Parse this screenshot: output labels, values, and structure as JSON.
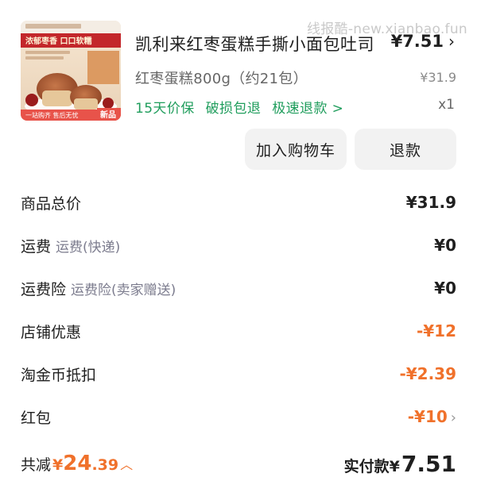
{
  "watermark": "线报酷-new.xianbao.fun",
  "product": {
    "image_alt": "凯利来红枣蛋糕商品图",
    "image_banner": "浓郁枣香 口口软糯",
    "image_badge": "新品",
    "image_footer": "一站购齐 售后无忧",
    "title": "凯利来红枣蛋糕手撕小面包吐司",
    "price": "¥7.51",
    "spec": "红枣蛋糕800g（约21包）",
    "original_price": "¥31.9",
    "tags": [
      "15天价保",
      "破损包退",
      "极速退款 >"
    ],
    "quantity": "x1"
  },
  "buttons": {
    "add_to_cart": "加入购物车",
    "refund": "退款"
  },
  "summary": {
    "total_price": {
      "label": "商品总价",
      "value": "¥31.9"
    },
    "shipping": {
      "label": "运费",
      "sub": "运费(快递)",
      "value": "¥0"
    },
    "shipping_insurance": {
      "label": "运费险",
      "sub": "运费险(卖家赠送)",
      "value": "¥0"
    },
    "store_discount": {
      "label": "店铺优惠",
      "value": "-¥12"
    },
    "coin_deduction": {
      "label": "淘金币抵扣",
      "value": "-¥2.39"
    },
    "red_packet": {
      "label": "红包",
      "value": "-¥10"
    }
  },
  "footer": {
    "reduced_label": "共减",
    "reduced_currency": "¥",
    "reduced_int": "24",
    "reduced_dec": ".39",
    "paid_label": "实付款",
    "paid_currency": "¥",
    "paid_value": "7.51"
  },
  "colors": {
    "accent_orange": "#f0712b",
    "tag_green": "#1f9d5c",
    "button_bg": "#f2f2f2"
  }
}
